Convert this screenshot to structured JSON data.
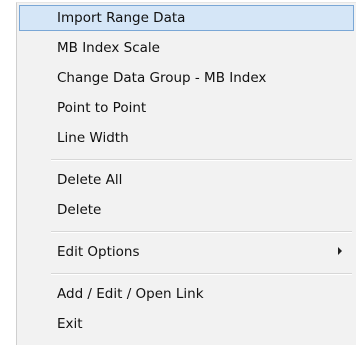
{
  "menu": {
    "items": [
      {
        "label": "Import Range Data"
      },
      {
        "label": "MB Index Scale"
      },
      {
        "label": "Change Data Group - MB Index"
      },
      {
        "label": "Point to Point"
      },
      {
        "label": "Line Width"
      },
      {
        "label": "Delete All"
      },
      {
        "label": "Delete"
      },
      {
        "label": "Edit Options"
      },
      {
        "label": "Add / Edit / Open Link"
      },
      {
        "label": "Exit"
      }
    ],
    "highlighted_label": "Import Range Data",
    "submenu_icon": "chevron-right-icon",
    "colors": {
      "highlight_fill": "#d5e6f7",
      "highlight_border": "#7aa7d6",
      "menu_background": "#f2f2f2"
    }
  }
}
